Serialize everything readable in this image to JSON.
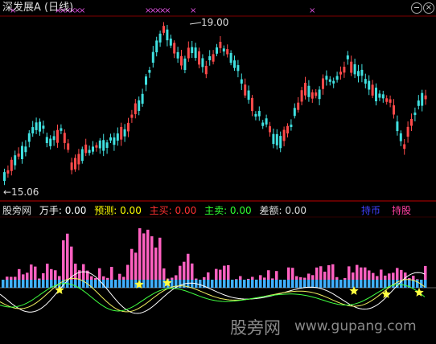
{
  "header": {
    "title": "深发展A (日线)",
    "title_color": "#dddddd",
    "markers": [
      {
        "x_index": 4,
        "symbol": "×"
      },
      {
        "x_index": 10,
        "symbol": "×"
      },
      {
        "x_index": 11,
        "symbol": "×"
      },
      {
        "x_index": 12,
        "symbol": "×"
      },
      {
        "x_index": 13,
        "symbol": "×"
      },
      {
        "x_index": 14,
        "symbol": "×"
      },
      {
        "x_index": 15,
        "symbol": "×"
      },
      {
        "x_index": 16,
        "symbol": "×"
      },
      {
        "x_index": 17,
        "symbol": "×"
      },
      {
        "x_index": 18,
        "symbol": "×"
      },
      {
        "x_index": 19,
        "symbol": "×"
      },
      {
        "x_index": 20,
        "symbol": "×"
      },
      {
        "x_index": 21,
        "symbol": "×"
      },
      {
        "x_index": 27,
        "symbol": "×"
      }
    ],
    "marker_color": "#e050e0"
  },
  "window_buttons": [
    "minimize",
    "close"
  ],
  "price_panel": {
    "high_label": "19.00",
    "low_label": "←15.06",
    "up_color": "#ff4a4a",
    "down_color": "#40e0e0"
  },
  "indicator_bar": {
    "items": [
      {
        "label": "股旁网",
        "color": "#dddddd"
      },
      {
        "label": "万手: 0.00",
        "color": "#ffffff"
      },
      {
        "label": "预测: 0.00",
        "color": "#ffff00"
      },
      {
        "label": "主买: 0.00",
        "color": "#ff3030"
      },
      {
        "label": "主卖: 0.00",
        "color": "#30ff30"
      },
      {
        "label": "差额: 0.00",
        "color": "#dddddd"
      }
    ],
    "right_labels": [
      {
        "label": "持币",
        "color": "#4040ff"
      },
      {
        "label": "持股",
        "color": "#ff40a0"
      }
    ]
  },
  "volume_panel": {
    "bar_pink": "#ff60c0",
    "bar_blue": "#40b0ff",
    "line_white": "#ffffff",
    "line_yellow": "#f0f060",
    "line_green": "#40ff40",
    "star_color": "#ffff40"
  },
  "watermark": {
    "cn": "股旁网",
    "url": "www.gupang.com"
  }
}
